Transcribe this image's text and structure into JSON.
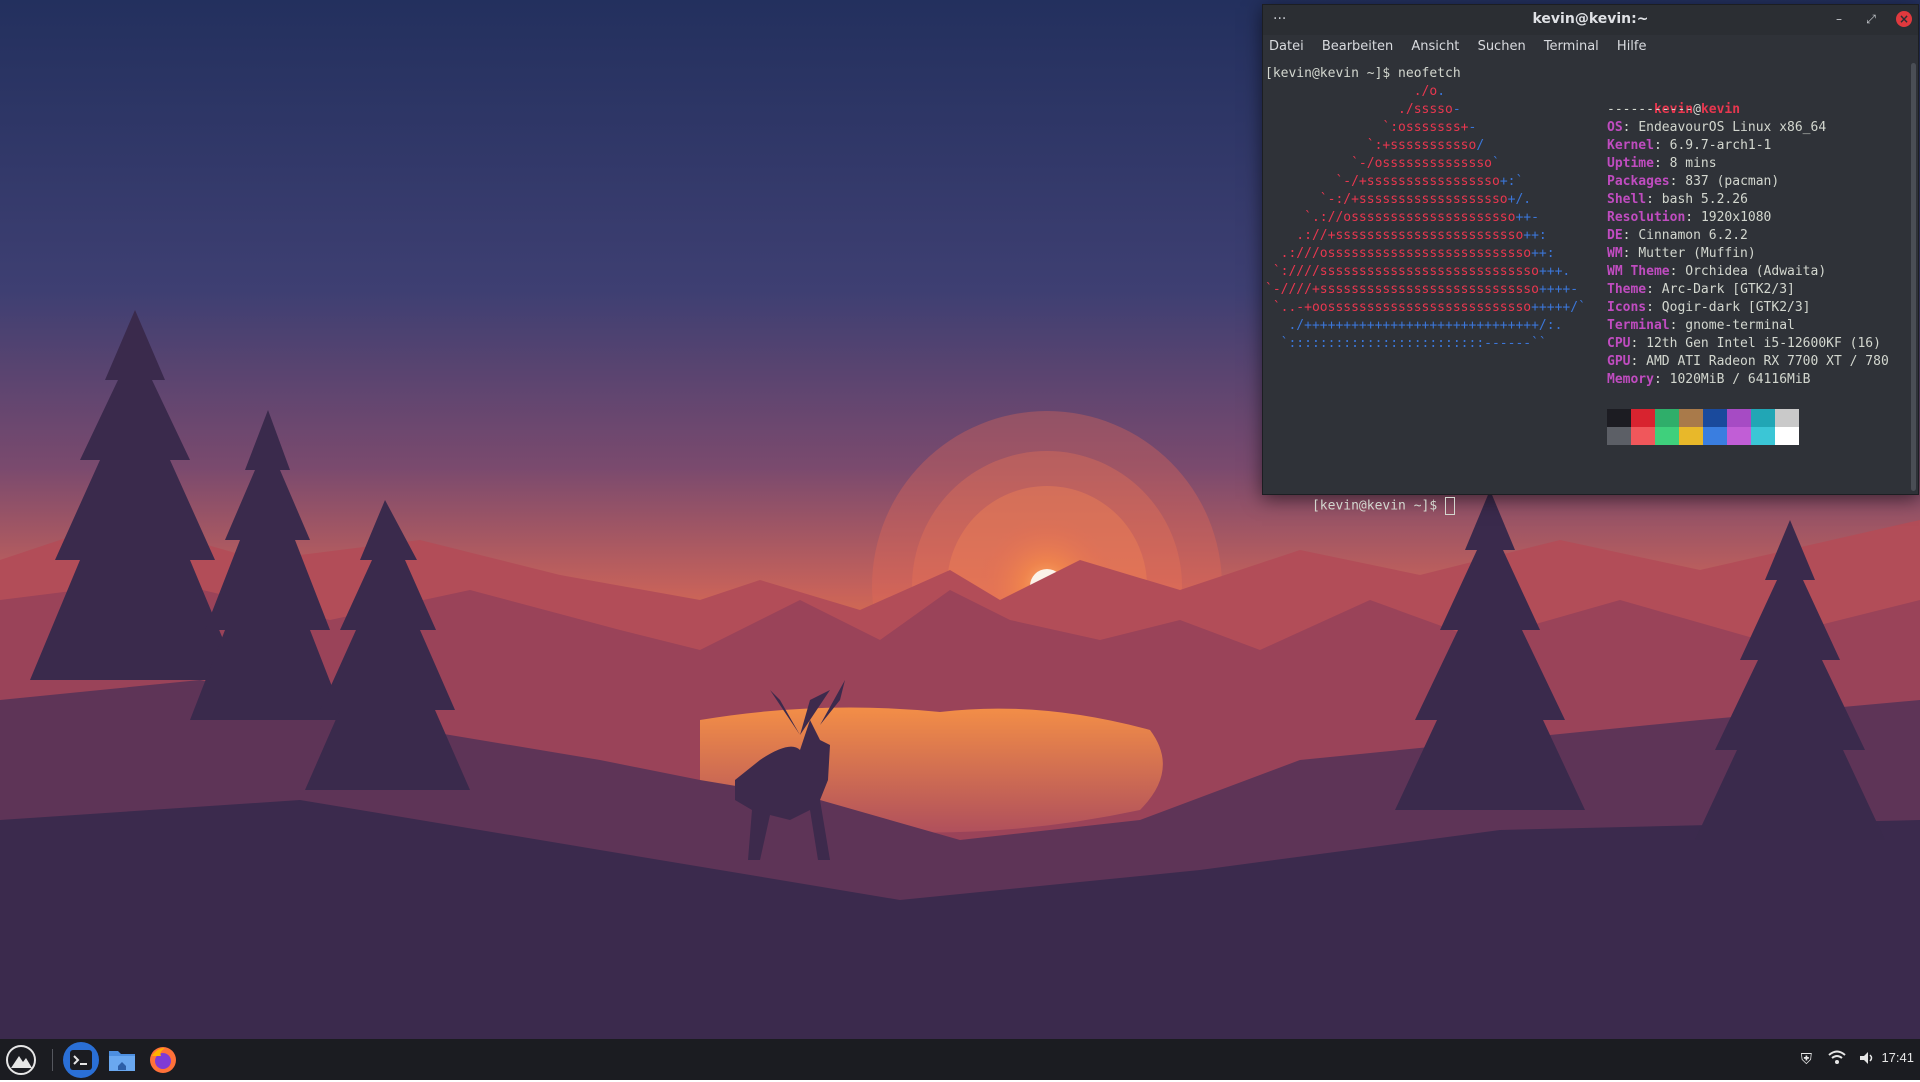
{
  "terminal": {
    "title": "kevin@kevin:~",
    "menu": [
      "Datei",
      "Bearbeiten",
      "Ansicht",
      "Suchen",
      "Terminal",
      "Hilfe"
    ],
    "prompt1": "[kevin@kevin ~]$ neofetch",
    "prompt2": "[kevin@kevin ~]$ ",
    "art": [
      {
        "r": "                   ./o",
        "b": "."
      },
      {
        "r": "                 ./sssso",
        "b": "-"
      },
      {
        "r": "               `:osssssss+",
        "b": "-"
      },
      {
        "r": "             `:+sssssssssso",
        "b": "/"
      },
      {
        "r": "           `-/ossssssssssssso",
        "b": "`"
      },
      {
        "r": "         `-/+sssssssssssssssso",
        "b": "+:`"
      },
      {
        "r": "       `-:/+sssssssssssssssssso",
        "b": "+/."
      },
      {
        "r": "     `.://osssssssssssssssssssso",
        "b": "++-"
      },
      {
        "r": "    .://+ssssssssssssssssssssssso",
        "b": "++:"
      },
      {
        "r": "  .:///ossssssssssssssssssssssssso",
        "b": "++:"
      },
      {
        "r": " `:////ssssssssssssssssssssssssssso",
        "b": "+++."
      },
      {
        "r": "`-////+ssssssssssssssssssssssssssso",
        "b": "++++-"
      },
      {
        "r": " `..-+oossssssssssssssssssssssssso",
        "b": "+++++/`"
      },
      {
        "r": "",
        "b": "   ./++++++++++++++++++++++++++++++/:."
      },
      {
        "r": "",
        "b": "  `:::::::::::::::::::::::::------``"
      }
    ],
    "user": "kevin",
    "host": "kevin",
    "separator": "-----------",
    "info": [
      {
        "label": "OS",
        "value": "EndeavourOS Linux x86_64"
      },
      {
        "label": "Kernel",
        "value": "6.9.7-arch1-1"
      },
      {
        "label": "Uptime",
        "value": "8 mins"
      },
      {
        "label": "Packages",
        "value": "837 (pacman)"
      },
      {
        "label": "Shell",
        "value": "bash 5.2.26"
      },
      {
        "label": "Resolution",
        "value": "1920x1080"
      },
      {
        "label": "DE",
        "value": "Cinnamon 6.2.2"
      },
      {
        "label": "WM",
        "value": "Mutter (Muffin)"
      },
      {
        "label": "WM Theme",
        "value": "Orchidea (Adwaita)"
      },
      {
        "label": "Theme",
        "value": "Arc-Dark [GTK2/3]"
      },
      {
        "label": "Icons",
        "value": "Qogir-dark [GTK2/3]"
      },
      {
        "label": "Terminal",
        "value": "gnome-terminal"
      },
      {
        "label": "CPU",
        "value": "12th Gen Intel i5-12600KF (16)"
      },
      {
        "label": "GPU",
        "value": "AMD ATI Radeon RX 7700 XT / 780"
      },
      {
        "label": "Memory",
        "value": "1020MiB / 64116MiB"
      }
    ],
    "palette_top": [
      "#1c1c22",
      "#d8232f",
      "#2fae6a",
      "#a97a4a",
      "#1a4a9c",
      "#a64bc4",
      "#21a6b5",
      "#c9c9c9"
    ],
    "palette_bottom": [
      "#5c5f66",
      "#f0575b",
      "#3fd07c",
      "#e8b82a",
      "#3a7ee0",
      "#c15ed6",
      "#3bc6d6",
      "#ffffff"
    ]
  },
  "taskbar": {
    "apps": [
      "menu-icon",
      "terminal-icon",
      "file-manager-icon",
      "firefox-icon"
    ],
    "clock": "17:41",
    "tray": [
      "shield-icon",
      "wifi-icon",
      "volume-icon"
    ]
  },
  "colors": {
    "accent": "#3b76d8",
    "art_primary": "#e8374f",
    "label": "#c04cc0"
  }
}
